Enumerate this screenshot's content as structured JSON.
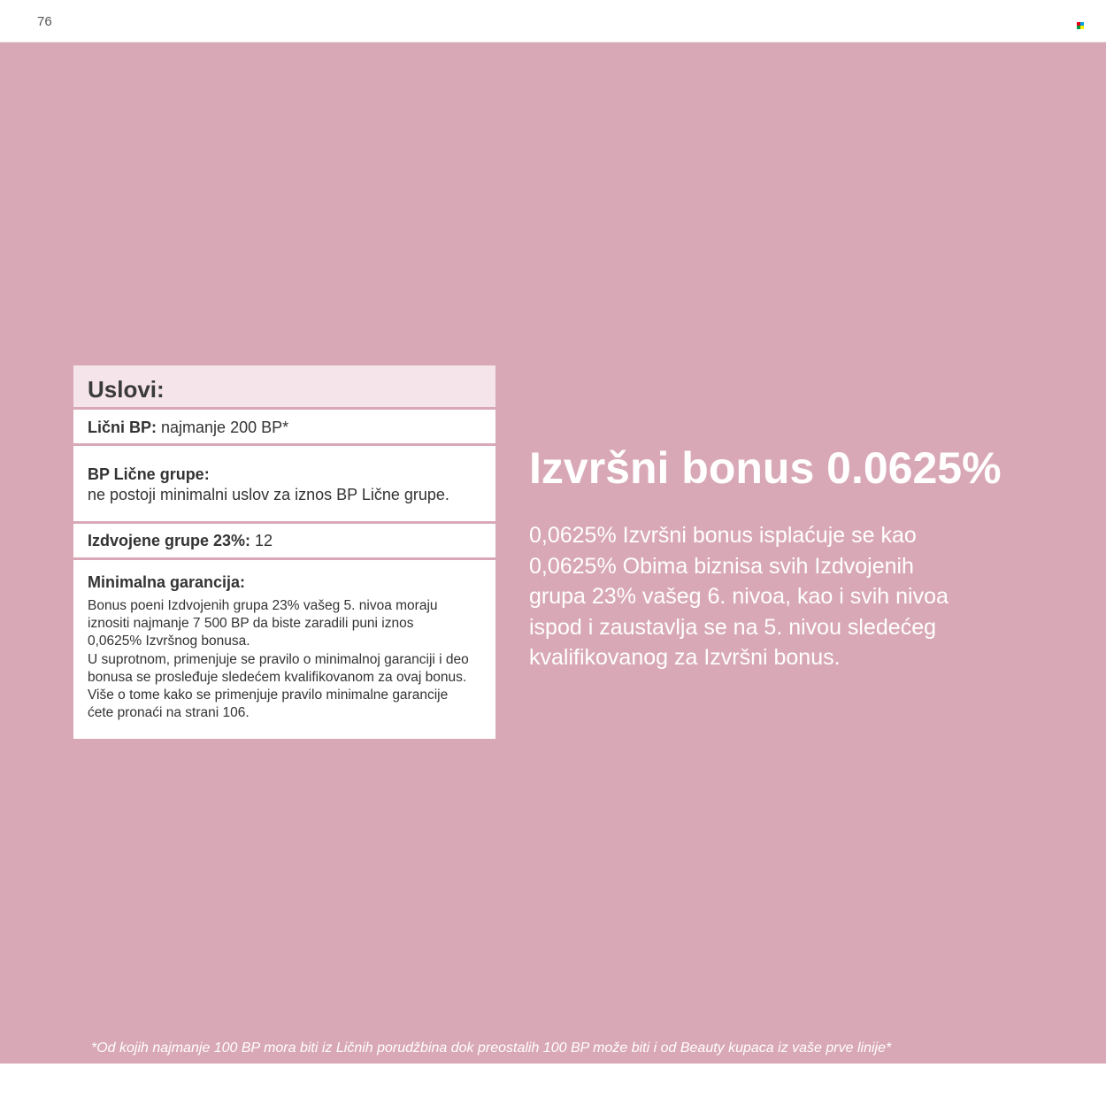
{
  "header": {
    "page_number": "76",
    "brand_mark_colors": [
      "#e60012",
      "#00a0e9",
      "#009944",
      "#fff100"
    ]
  },
  "colors": {
    "panel_background": "#d9a8b6",
    "card_title_background": "#f5e4ea",
    "text_white": "#ffffff"
  },
  "conditions": {
    "title": "Uslovi:",
    "personal_bp": {
      "label": "Lični BP:",
      "value": " najmanje 200 BP*"
    },
    "personal_group_bp": {
      "label": "BP Lične grupe:",
      "value": "ne postoji minimalni uslov za iznos BP Lične grupe."
    },
    "separated_groups": {
      "label": "Izdvojene grupe 23%:",
      "value": " 12"
    },
    "minimum_guarantee": {
      "label": "Minimalna garancija:",
      "text": "Bonus poeni Izdvojenih grupa 23% vašeg 5. nivoa moraju\niznositi najmanje 7 500 BP da biste zaradili puni iznos\n0,0625% Izvršnog bonusa.\nU suprotnom, primenjuje se pravilo o minimalnoj garanciji i deo\nbonusa se prosleđuje sledećem kvalifikovanom za ovaj bonus.\nViše o tome kako se primenjuje pravilo minimalne garancije\nćete pronaći na strani 106."
    }
  },
  "main": {
    "headline": "Izvršni bonus 0.0625%",
    "description": "0,0625% Izvršni bonus isplaćuje se kao\n0,0625% Obima biznisa svih Izdvojenih\ngrupa 23% vašeg 6. nivoa, kao i svih nivoa\nispod i zaustavlja se na 5. nivou sledećeg\nkvalifikovanog za Izvršni bonus."
  },
  "footnote": "*Od kojih najmanje 100 BP mora biti iz Ličnih porudžbina dok preostalih 100 BP može biti i od Beauty kupaca iz vaše prve linije*"
}
